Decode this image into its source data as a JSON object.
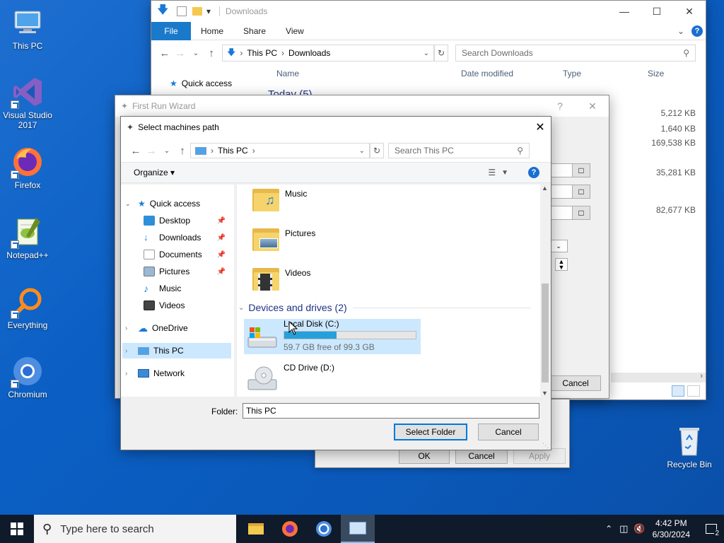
{
  "desktop": {
    "icons": [
      {
        "label": "This PC"
      },
      {
        "label": "Visual Studio 2017"
      },
      {
        "label": "Firefox"
      },
      {
        "label": "Notepad++"
      },
      {
        "label": "Everything"
      },
      {
        "label": "Chromium"
      },
      {
        "label": "Recycle Bin"
      }
    ]
  },
  "explorer": {
    "title": "Downloads",
    "ribbon_tabs": [
      "File",
      "Home",
      "Share",
      "View"
    ],
    "breadcrumb": [
      "This PC",
      "Downloads"
    ],
    "search_placeholder": "Search Downloads",
    "columns": {
      "name": "Name",
      "date": "Date modified",
      "type": "Type",
      "size": "Size"
    },
    "quick_access": "Quick access",
    "group": "Today (5)",
    "sizes": [
      "5,212 KB",
      "1,640 KB",
      "169,538 KB",
      "35,281 KB",
      "82,677 KB"
    ]
  },
  "wizard": {
    "title": "First Run Wizard",
    "help": "?",
    "cancel_label": "Cancel",
    "ok_label": "OK",
    "cancel2_label": "Cancel",
    "apply_label": "Apply"
  },
  "select_dialog": {
    "title": "Select machines path",
    "breadcrumb": "This PC",
    "search_placeholder": "Search This PC",
    "organize_label": "Organize",
    "nav": {
      "quick_access": "Quick access",
      "desktop": "Desktop",
      "downloads": "Downloads",
      "documents": "Documents",
      "pictures": "Pictures",
      "music": "Music",
      "videos": "Videos",
      "onedrive": "OneDrive",
      "this_pc": "This PC",
      "network": "Network"
    },
    "folders": [
      "Music",
      "Pictures",
      "Videos"
    ],
    "devices_header": "Devices and drives (2)",
    "drive_c": {
      "name": "Local Disk (C:)",
      "free": "59.7 GB free of 99.3 GB",
      "used_fraction": 0.4
    },
    "drive_d": {
      "name": "CD Drive (D:)"
    },
    "folder_label": "Folder:",
    "folder_value": "This PC",
    "select_label": "Select Folder",
    "cancel_label": "Cancel"
  },
  "taskbar": {
    "search_placeholder": "Type here to search",
    "time": "4:42 PM",
    "date": "6/30/2024",
    "notifications": "2"
  },
  "colors": {
    "accent": "#0078d7",
    "desktop": "#0b5fc4",
    "drive_bar": "#26a0da"
  }
}
